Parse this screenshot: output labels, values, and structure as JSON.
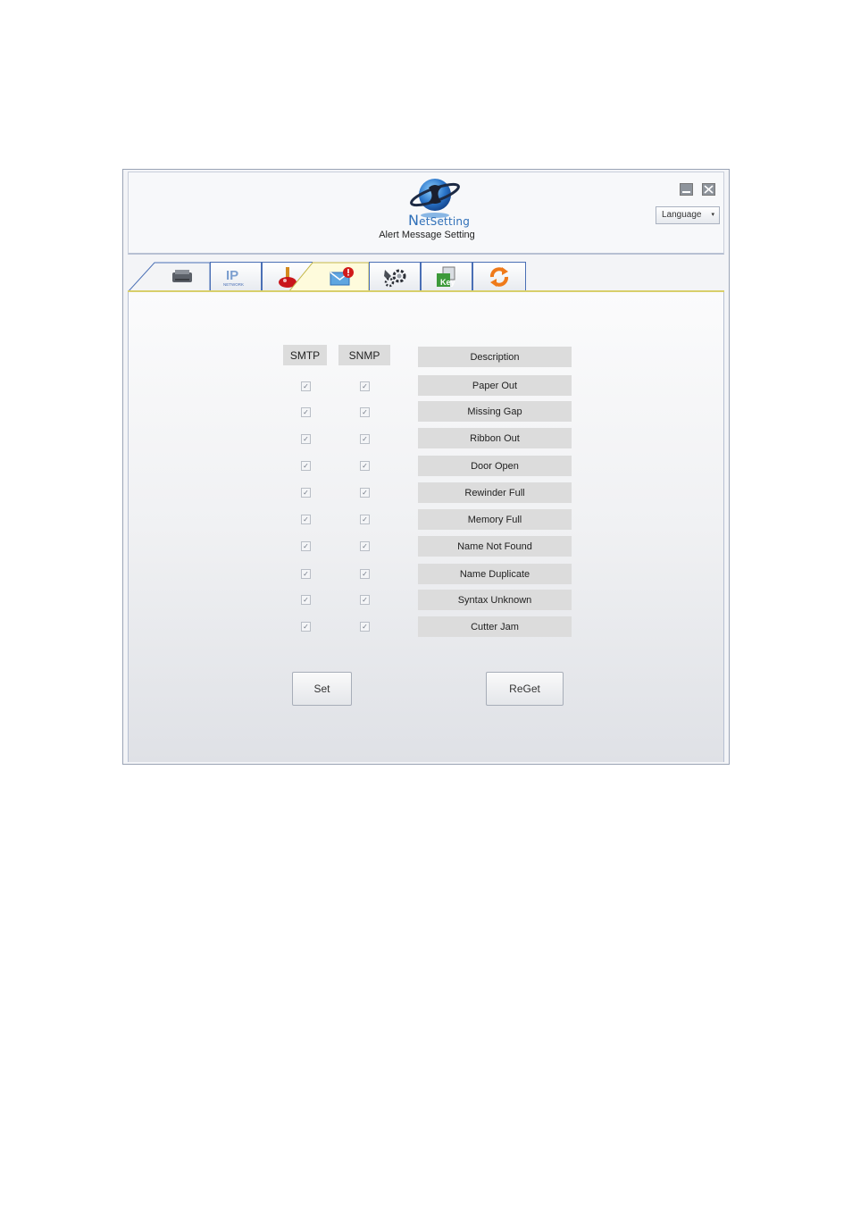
{
  "window": {
    "logo_text_first": "N",
    "logo_text_rest": "etSetting",
    "subtitle": "Alert Message Setting",
    "minimize_icon": "minimize-icon",
    "close_icon": "close-icon",
    "language_label": "Language",
    "language_caret": "▾"
  },
  "tabs": [
    {
      "name": "printer",
      "icon": "printer-icon"
    },
    {
      "name": "ip-network",
      "icon": "ip-network-icon",
      "text": "IP",
      "subtext": "NETWORK"
    },
    {
      "name": "joystick",
      "icon": "joystick-icon"
    },
    {
      "name": "alert",
      "icon": "alert-mail-icon",
      "active": true
    },
    {
      "name": "settings",
      "icon": "gears-icon"
    },
    {
      "name": "key",
      "icon": "key-icon",
      "text": "Key"
    },
    {
      "name": "refresh",
      "icon": "refresh-icon"
    }
  ],
  "table": {
    "headers": {
      "smtp": "SMTP",
      "snmp": "SNMP",
      "description": "Description"
    },
    "check_glyph": "✓",
    "rows": [
      {
        "description": "Paper Out",
        "smtp": true,
        "snmp": true
      },
      {
        "description": "Missing Gap",
        "smtp": true,
        "snmp": true
      },
      {
        "description": "Ribbon Out",
        "smtp": true,
        "snmp": true
      },
      {
        "description": "Door Open",
        "smtp": true,
        "snmp": true
      },
      {
        "description": "Rewinder Full",
        "smtp": true,
        "snmp": true
      },
      {
        "description": "Memory Full",
        "smtp": true,
        "snmp": true
      },
      {
        "description": "Name Not Found",
        "smtp": true,
        "snmp": true
      },
      {
        "description": "Name Duplicate",
        "smtp": true,
        "snmp": true
      },
      {
        "description": "Syntax Unknown",
        "smtp": true,
        "snmp": true
      },
      {
        "description": "Cutter Jam",
        "smtp": true,
        "snmp": true
      }
    ]
  },
  "buttons": {
    "set": "Set",
    "reget": "ReGet"
  },
  "colors": {
    "tab_border": "#4a6fb5",
    "active_tab": "#fefbdc",
    "header_fill": "#dcdcdc"
  }
}
